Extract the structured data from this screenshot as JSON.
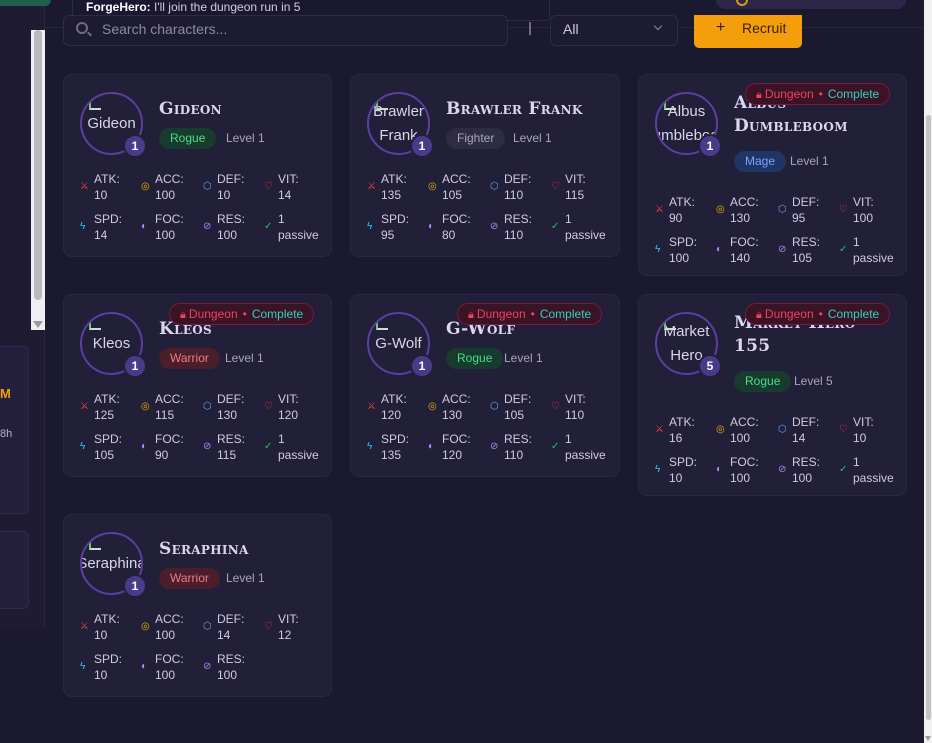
{
  "chat": {
    "author": "ForgeHero:",
    "message": "I'll join the dungeon run in 5"
  },
  "search": {
    "placeholder": "Search characters..."
  },
  "filter": {
    "selected": "All"
  },
  "recruit": {
    "label": "Recruit",
    "icon": "+"
  },
  "left_panel": {
    "fragment1": "M",
    "fragment2": "8h"
  },
  "icons": {
    "atk": "⚔",
    "acc": "◎",
    "def": "⬡",
    "vit": "♡",
    "spd": "ϟ",
    "foc": "◐",
    "res": "⊘",
    "pas": "✓"
  },
  "stat_labels": {
    "atk": "ATK:",
    "acc": "ACC:",
    "def": "DEF:",
    "vit": "VIT:",
    "spd": "SPD:",
    "foc": "FOC:",
    "res": "RES:"
  },
  "dungeon_badge": {
    "dungeon": "Dungeon",
    "separator": "•",
    "complete": "Complete"
  },
  "characters": [
    {
      "name": "Gideon",
      "avatar_alt": "Gideon",
      "level_badge": "1",
      "class": "Rogue",
      "level": "Level 1",
      "atk": "10",
      "acc": "100",
      "def": "10",
      "vit": "14",
      "spd": "14",
      "foc": "100",
      "res": "100",
      "passive": "1 passive",
      "dungeon": false
    },
    {
      "name": "Brawler Frank",
      "avatar_alt": "Brawler Frank",
      "level_badge": "1",
      "class": "Fighter",
      "level": "Level 1",
      "atk": "135",
      "acc": "105",
      "def": "110",
      "vit": "115",
      "spd": "95",
      "foc": "80",
      "res": "110",
      "passive": "1 passive",
      "dungeon": false
    },
    {
      "name": "Albus Dumbleboom",
      "avatar_alt": "Albus Dumbleboom",
      "level_badge": "1",
      "class": "Mage",
      "level": "Level 1",
      "atk": "90",
      "acc": "130",
      "def": "95",
      "vit": "100",
      "spd": "100",
      "foc": "140",
      "res": "105",
      "passive": "1 passive",
      "dungeon": true
    },
    {
      "name": "Kleos",
      "avatar_alt": "Kleos",
      "level_badge": "1",
      "class": "Warrior",
      "level": "Level 1",
      "atk": "125",
      "acc": "115",
      "def": "130",
      "vit": "120",
      "spd": "105",
      "foc": "90",
      "res": "115",
      "passive": "1 passive",
      "dungeon": true
    },
    {
      "name": "G-Wolf",
      "avatar_alt": "G-Wolf",
      "level_badge": "1",
      "class": "Rogue",
      "level": "Level 1",
      "atk": "120",
      "acc": "130",
      "def": "105",
      "vit": "110",
      "spd": "135",
      "foc": "120",
      "res": "110",
      "passive": "1 passive",
      "dungeon": true
    },
    {
      "name": "Market Hero 155",
      "avatar_alt": "Market Hero",
      "level_badge": "5",
      "class": "Rogue",
      "level": "Level 5",
      "atk": "16",
      "acc": "100",
      "def": "14",
      "vit": "10",
      "spd": "10",
      "foc": "100",
      "res": "100",
      "passive": "1 passive",
      "dungeon": true
    },
    {
      "name": "Seraphina",
      "avatar_alt": "Seraphina",
      "level_badge": "1",
      "class": "Warrior",
      "level": "Level 1",
      "atk": "10",
      "acc": "100",
      "def": "14",
      "vit": "12",
      "spd": "10",
      "foc": "100",
      "res": "100",
      "passive": "",
      "dungeon": false
    }
  ]
}
